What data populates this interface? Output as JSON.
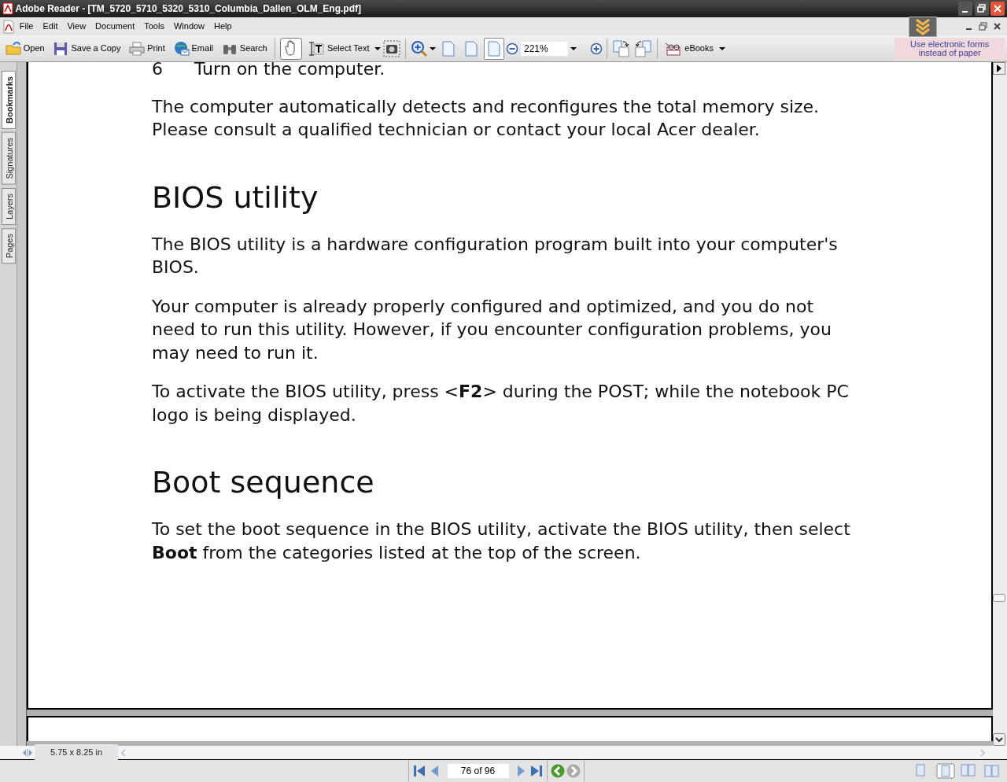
{
  "window": {
    "title": "Adobe Reader - [TM_5720_5710_5320_5310_Columbia_Dallen_OLM_Eng.pdf]"
  },
  "menu": [
    "File",
    "Edit",
    "View",
    "Document",
    "Tools",
    "Window",
    "Help"
  ],
  "toolbar": {
    "file_buttons": [
      {
        "label": "Open"
      },
      {
        "label": "Save a Copy"
      },
      {
        "label": "Print"
      },
      {
        "label": "Email"
      },
      {
        "label": "Search"
      }
    ],
    "hand_tool": {
      "selected": true
    },
    "select_text": {
      "label": "Select Text",
      "selected": false
    },
    "page_views": [
      {
        "selected": false
      },
      {
        "selected": false
      },
      {
        "selected": true
      }
    ],
    "zoom_field": {
      "value": "221%"
    },
    "ebooks": {
      "label": "eBooks"
    }
  },
  "banner": {
    "text": "Use electronic forms instead of paper"
  },
  "side_tabs": [
    {
      "label": "Bookmarks",
      "selected": true
    },
    {
      "label": "Signatures",
      "selected": false
    },
    {
      "label": "Layers",
      "selected": false
    },
    {
      "label": "Pages",
      "selected": false
    }
  ],
  "document": [
    {
      "kind": "step",
      "number": "6",
      "text": "Turn on the computer."
    },
    {
      "kind": "para",
      "text": "The computer automatically detects and reconfigures the total memory size. Please consult a qualified technician or contact your local Acer dealer."
    },
    {
      "kind": "heading",
      "text": "BIOS utility"
    },
    {
      "kind": "para",
      "text": "The BIOS utility is a hardware configuration program built into your computer's BIOS."
    },
    {
      "kind": "para",
      "text": "Your computer is already properly configured and optimized, and you do not need to run this utility. However, if you encounter configuration problems, you may need to run it."
    },
    {
      "kind": "para",
      "text": "To activate the BIOS utility, press <**F2**> during the POST; while the notebook PC logo is being displayed."
    },
    {
      "kind": "heading",
      "text": "Boot sequence"
    },
    {
      "kind": "para",
      "text": "To set the boot sequence in the BIOS utility, activate the BIOS utility, then select **Boot** from the categories listed at the top of the screen."
    }
  ],
  "page_size": "5.75 x 8.25 in",
  "page_field": {
    "value": "76 of 96"
  }
}
